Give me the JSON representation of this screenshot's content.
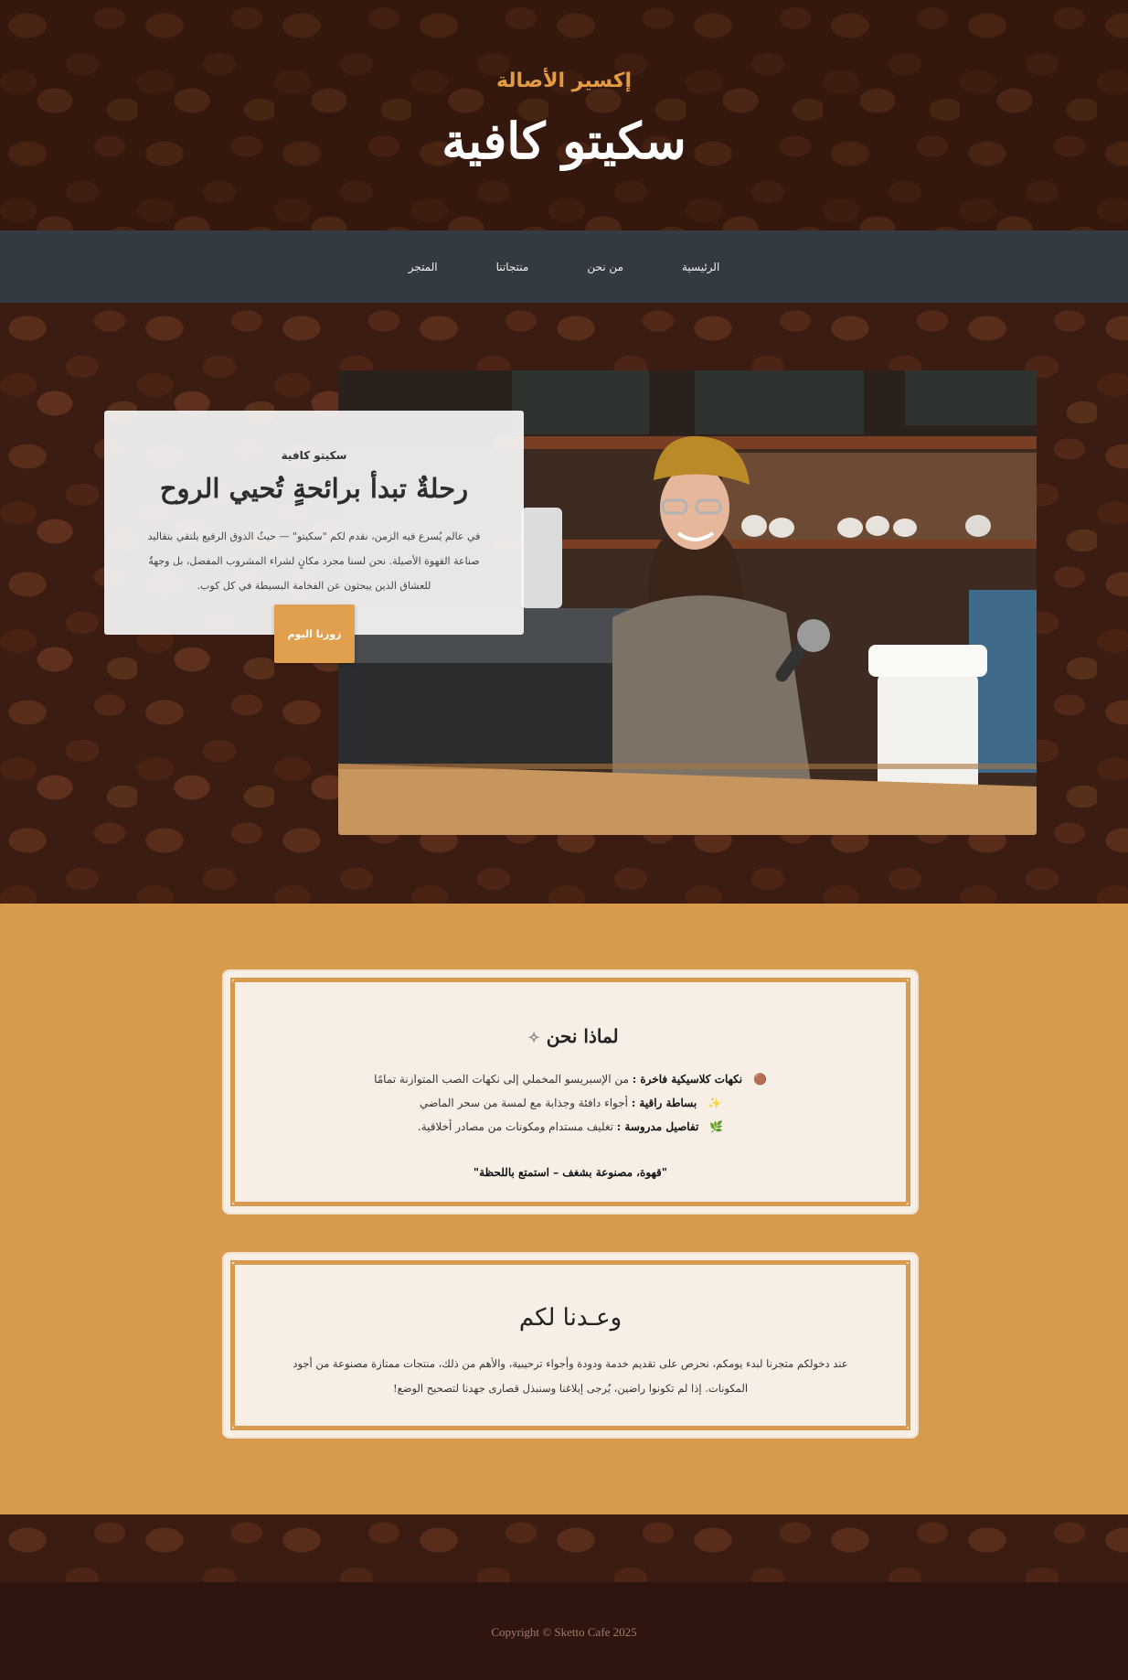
{
  "header": {
    "tagline": "إكسير الأصالة",
    "brand": "سكيتو كافية"
  },
  "nav": {
    "items": [
      {
        "label": "الرئيسية"
      },
      {
        "label": "من نحن"
      },
      {
        "label": "منتجاتنا"
      },
      {
        "label": "المتجر"
      }
    ]
  },
  "hero": {
    "kicker": "سكيتو كافية",
    "headline": "رحلةٌ تبدأ برائحةٍ تُحيي الروح",
    "description": "في عالم يُسرع فيه الزمن، نقدم لكم \"سكيتو\" — حيثُ الذوق الرفيع يلتقي بتقاليد صناعة القهوة الأصيلة. نحن لسنا مجرد مكانٍ لشراء المشروب المفضل، بل وجهةٌ للعشاق الذين يبحثون عن الفخامة البسيطة في كل كوب.",
    "button_label": "زورنا اليوم"
  },
  "why_us": {
    "title": "لماذا نحن",
    "title_icon": "✧",
    "items": [
      {
        "emoji": "🟤",
        "bold": "نكهات كلاسيكية فاخرة :",
        "text": " من الإسبريسو المخملي إلى نكهات الصب المتوازنة تمامًا"
      },
      {
        "emoji": "✨",
        "bold": "بساطة راقية :",
        "text": " أجواء دافئة وجذابة مع لمسة من سحر الماضي"
      },
      {
        "emoji": "🌿",
        "bold": "تفاصيل مدروسة :",
        "text": " تغليف مستدام ومكونات من مصادر أخلاقية."
      }
    ],
    "quote": "\"قهوة، مصنوعة بشغف – استمتع باللحظة\""
  },
  "promise": {
    "title": "وعـدنا لكم",
    "text": "عند دخولكم متجرنا لبدء يومكم، نحرص على تقديم خدمة ودودة وأجواء ترحيبية، والأهم من ذلك، منتجات ممتازة مصنوعة من أجود المكونات. إذا لم تكونوا راضين، يُرجى إبلاغنا وسنبذل قصارى جهدنا لتصحيح الوضع!"
  },
  "footer": {
    "copyright": "Copyright © Sketto Cafe 2025"
  },
  "colors": {
    "accent": "#e39b40",
    "nav_bg": "#343a42",
    "section_bg": "#d89a4f",
    "panel_bg": "#f7efe6",
    "footer_bg": "#2f150f"
  }
}
